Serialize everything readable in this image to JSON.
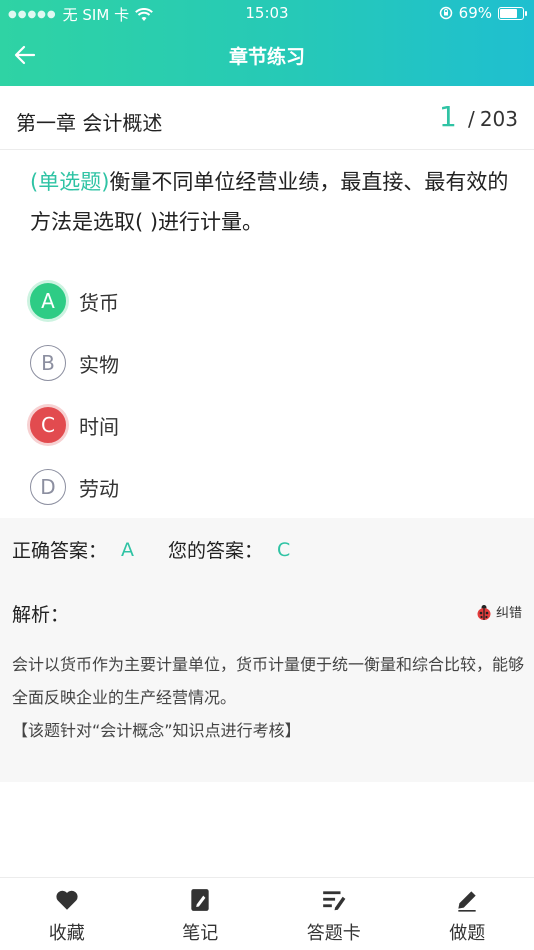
{
  "status_bar": {
    "carrier": "无 SIM 卡",
    "time": "15:03",
    "battery": "69%"
  },
  "nav": {
    "title": "章节练习"
  },
  "chapter": {
    "title": "第一章 会计概述",
    "current": "1",
    "separator": "/",
    "total": "203"
  },
  "question": {
    "type": "(单选题)",
    "text": "衡量不同单位经营业绩，最直接、最有效的方法是选取( )进行计量。"
  },
  "options": [
    {
      "letter": "A",
      "text": "货币",
      "state": "correct"
    },
    {
      "letter": "B",
      "text": "实物",
      "state": "normal"
    },
    {
      "letter": "C",
      "text": "时间",
      "state": "wrong"
    },
    {
      "letter": "D",
      "text": "劳动",
      "state": "normal"
    }
  ],
  "answer": {
    "correct_label": "正确答案：",
    "correct_value": "A",
    "yours_label": "您的答案：",
    "yours_value": "C"
  },
  "analysis": {
    "label": "解析：",
    "report_label": "纠错",
    "text": "会计以货币作为主要计量单位，货币计量便于统一衡量和综合比较，能够全面反映企业的生产经营情况。",
    "note": "【该题针对“会计概念”知识点进行考核】"
  },
  "tabbar": {
    "items": [
      {
        "label": "收藏",
        "icon": "heart-icon"
      },
      {
        "label": "笔记",
        "icon": "note-icon"
      },
      {
        "label": "答题卡",
        "icon": "answer-sheet-icon"
      },
      {
        "label": "做题",
        "icon": "pencil-icon"
      }
    ]
  },
  "colors": {
    "accent": "#2fc3a4",
    "correct": "#2ecc85",
    "wrong": "#e24b4f"
  }
}
